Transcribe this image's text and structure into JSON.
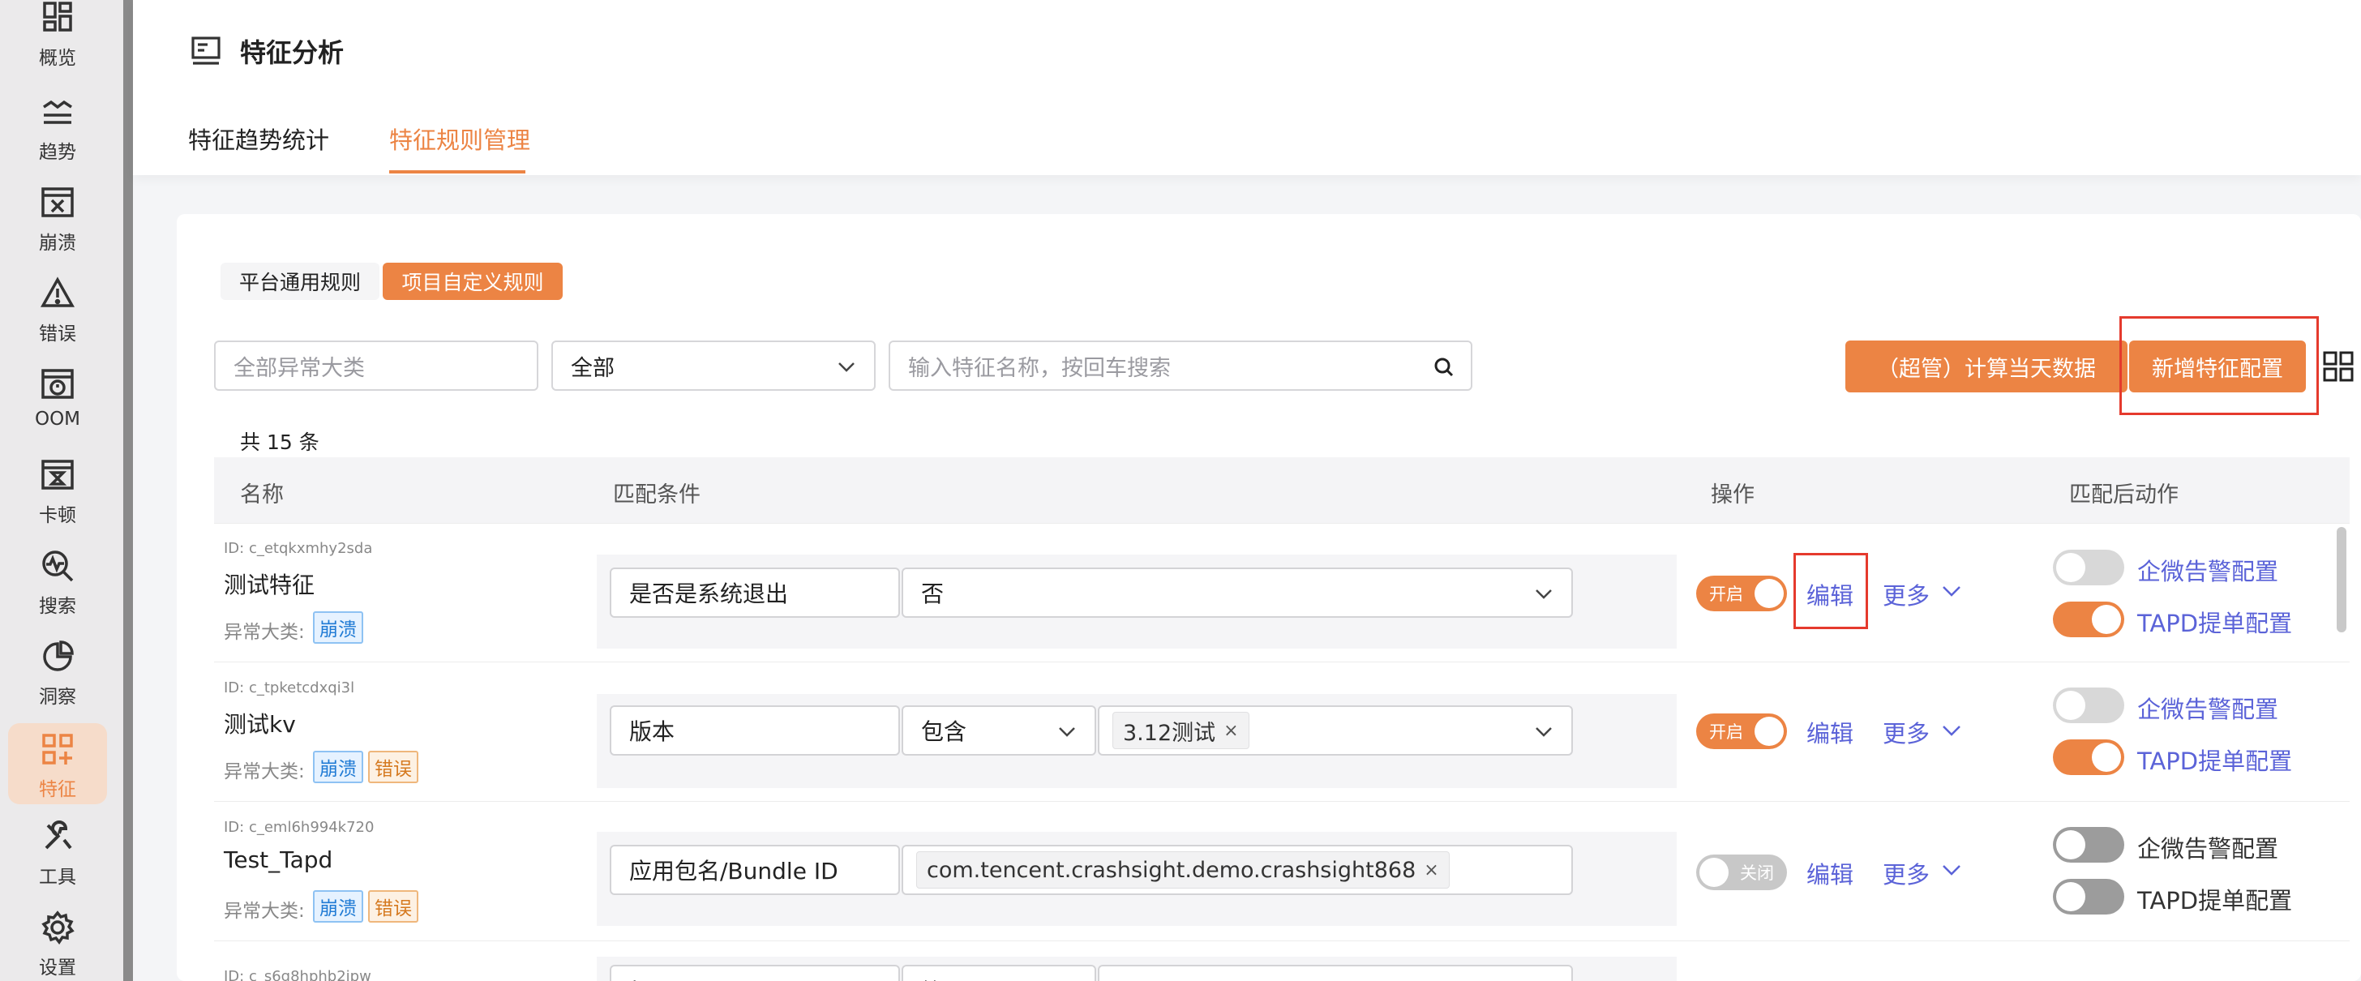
{
  "sidebar": {
    "items": [
      {
        "label": "概览",
        "icon": "dashboard-icon"
      },
      {
        "label": "趋势",
        "icon": "trend-icon"
      },
      {
        "label": "崩溃",
        "icon": "crash-icon"
      },
      {
        "label": "错误",
        "icon": "warning-icon"
      },
      {
        "label": "OOM",
        "icon": "memory-icon"
      },
      {
        "label": "卡顿",
        "icon": "hourglass-icon"
      },
      {
        "label": "搜索",
        "icon": "search-pulse-icon"
      },
      {
        "label": "洞察",
        "icon": "insight-pie-icon"
      },
      {
        "label": "特征",
        "icon": "feature-grid-icon",
        "active": true
      },
      {
        "label": "工具",
        "icon": "tools-icon"
      },
      {
        "label": "设置",
        "icon": "gear-icon"
      }
    ]
  },
  "header": {
    "title": "特征分析",
    "tabs": [
      {
        "label": "特征趋势统计"
      },
      {
        "label": "特征规则管理",
        "active": true
      }
    ]
  },
  "toolbar": {
    "segment_platform": "平台通用规则",
    "segment_project": "项目自定义规则",
    "category_placeholder": "全部异常大类",
    "status_select": "全部",
    "search_placeholder": "输入特征名称，按回车搜索",
    "compute_button": "（超管）计算当天数据",
    "add_button": "新增特征配置"
  },
  "table": {
    "total": "共 15 条",
    "columns": [
      "名称",
      "匹配条件",
      "操作",
      "匹配后动作"
    ],
    "category_label": "异常大类:",
    "edit_label": "编辑",
    "more_label": "更多",
    "wecom_label": "企微告警配置",
    "tapd_label": "TAPD提单配置",
    "rows": [
      {
        "id": "ID: c_etqkxmhy2sda",
        "name": "测试特征",
        "tags": [
          "崩溃"
        ],
        "field": "是否是系统退出",
        "value": "否",
        "status": "开启",
        "wecom_on": false,
        "tapd_on": true
      },
      {
        "id": "ID: c_tpketcdxqi3l",
        "name": "测试kv",
        "tags": [
          "崩溃",
          "错误"
        ],
        "field": "版本",
        "operator": "包含",
        "chip": "3.12测试",
        "status": "开启",
        "wecom_on": false,
        "tapd_on": true
      },
      {
        "id": "ID: c_eml6h994k720",
        "name": "Test_Tapd",
        "tags": [
          "崩溃",
          "错误"
        ],
        "field": "应用包名/Bundle ID",
        "chip": "com.tencent.crashsight.demo.crashsight868",
        "status": "关闭",
        "wecom_on": false,
        "tapd_on": false
      },
      {
        "id": "ID: c_s6g8hphb2ipw",
        "field": "标题",
        "operator": "等于"
      }
    ]
  },
  "colors": {
    "accent": "#ec8444",
    "link": "#5b63d8",
    "highlight_box": "#e53a2d"
  }
}
